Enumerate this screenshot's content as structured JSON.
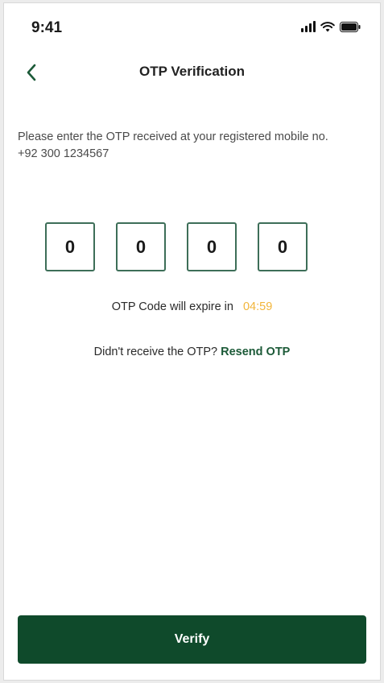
{
  "status_bar": {
    "time": "9:41",
    "icons": [
      "cellular-signal-icon",
      "wifi-icon",
      "battery-icon"
    ]
  },
  "header": {
    "back_icon": "chevron-left-icon",
    "title": "OTP Verification"
  },
  "instruction": {
    "line1": "Please enter the OTP received at your registered mobile no.",
    "line2": "+92 300 1234567"
  },
  "otp": {
    "digits": [
      "0",
      "0",
      "0",
      "0"
    ]
  },
  "expiry": {
    "label": "OTP Code will expire in",
    "timer": "04:59"
  },
  "resend": {
    "prompt": "Didn't receive the OTP?",
    "link": "Resend OTP"
  },
  "actions": {
    "verify_label": "Verify"
  },
  "colors": {
    "primary": "#0f4a2b",
    "accent_link": "#1c5a38",
    "timer": "#f2b53a",
    "otp_border": "#3d6e58"
  }
}
